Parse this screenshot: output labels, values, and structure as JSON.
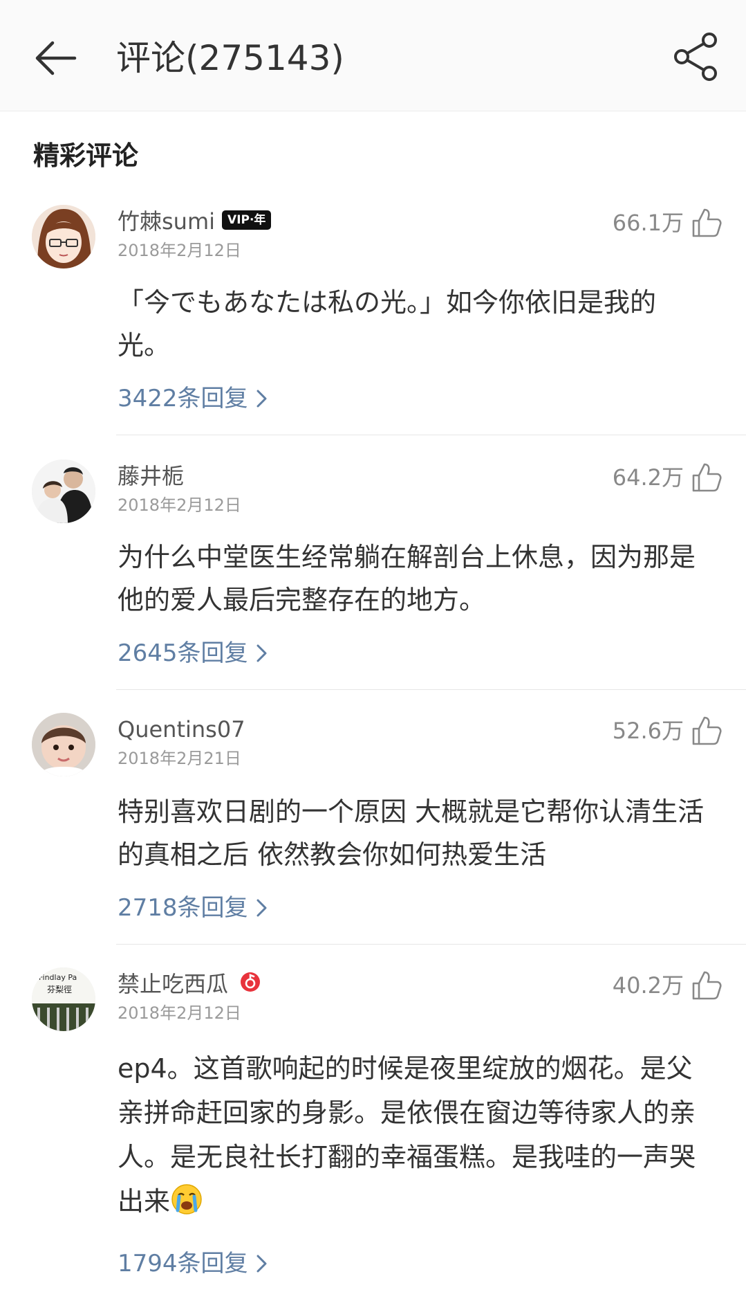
{
  "header": {
    "title": "评论(275143)"
  },
  "section": {
    "title": "精彩评论"
  },
  "colors": {
    "reply_link": "#5f7ea3",
    "verified_badge": "#e8333c",
    "text_primary": "#333333",
    "text_meta": "#9a9a9a"
  },
  "icons": {
    "back": "arrow-left-icon",
    "share": "share-icon",
    "like": "thumbs-up-icon",
    "reply_chevron": "chevron-right-icon",
    "verified": "music-note-badge-icon",
    "emoji": "crying-face-emoji"
  },
  "comments": [
    {
      "username": "竹棘sumi",
      "badge": "VIP·年",
      "date": "2018年2月12日",
      "likes": "66.1万",
      "text": "「今でもあなたは私の光。」如今你依旧是我的光。",
      "replies": "3422条回复"
    },
    {
      "username": "藤井栀",
      "date": "2018年2月12日",
      "likes": "64.2万",
      "text": "为什么中堂医生经常躺在解剖台上休息，因为那是他的爱人最后完整存在的地方。",
      "replies": "2645条回复"
    },
    {
      "username": "Quentins07",
      "date": "2018年2月21日",
      "likes": "52.6万",
      "text": "特别喜欢日剧的一个原因 大概就是它帮你认清生活的真相之后 依然教会你如何热爱生活",
      "replies": "2718条回复"
    },
    {
      "username": "禁止吃西瓜",
      "date": "2018年2月12日",
      "likes": "40.2万",
      "text": "ep4。这首歌响起的时候是夜里绽放的烟花。是父亲拼命赶回家的身影。是依偎在窗边等待家人的亲人。是无良社长打翻的幸福蛋糕。是我哇的一声哭出来",
      "replies": "1794条回复",
      "avatar_text": [
        "Findlay Pa",
        "芬梨徑"
      ]
    }
  ]
}
